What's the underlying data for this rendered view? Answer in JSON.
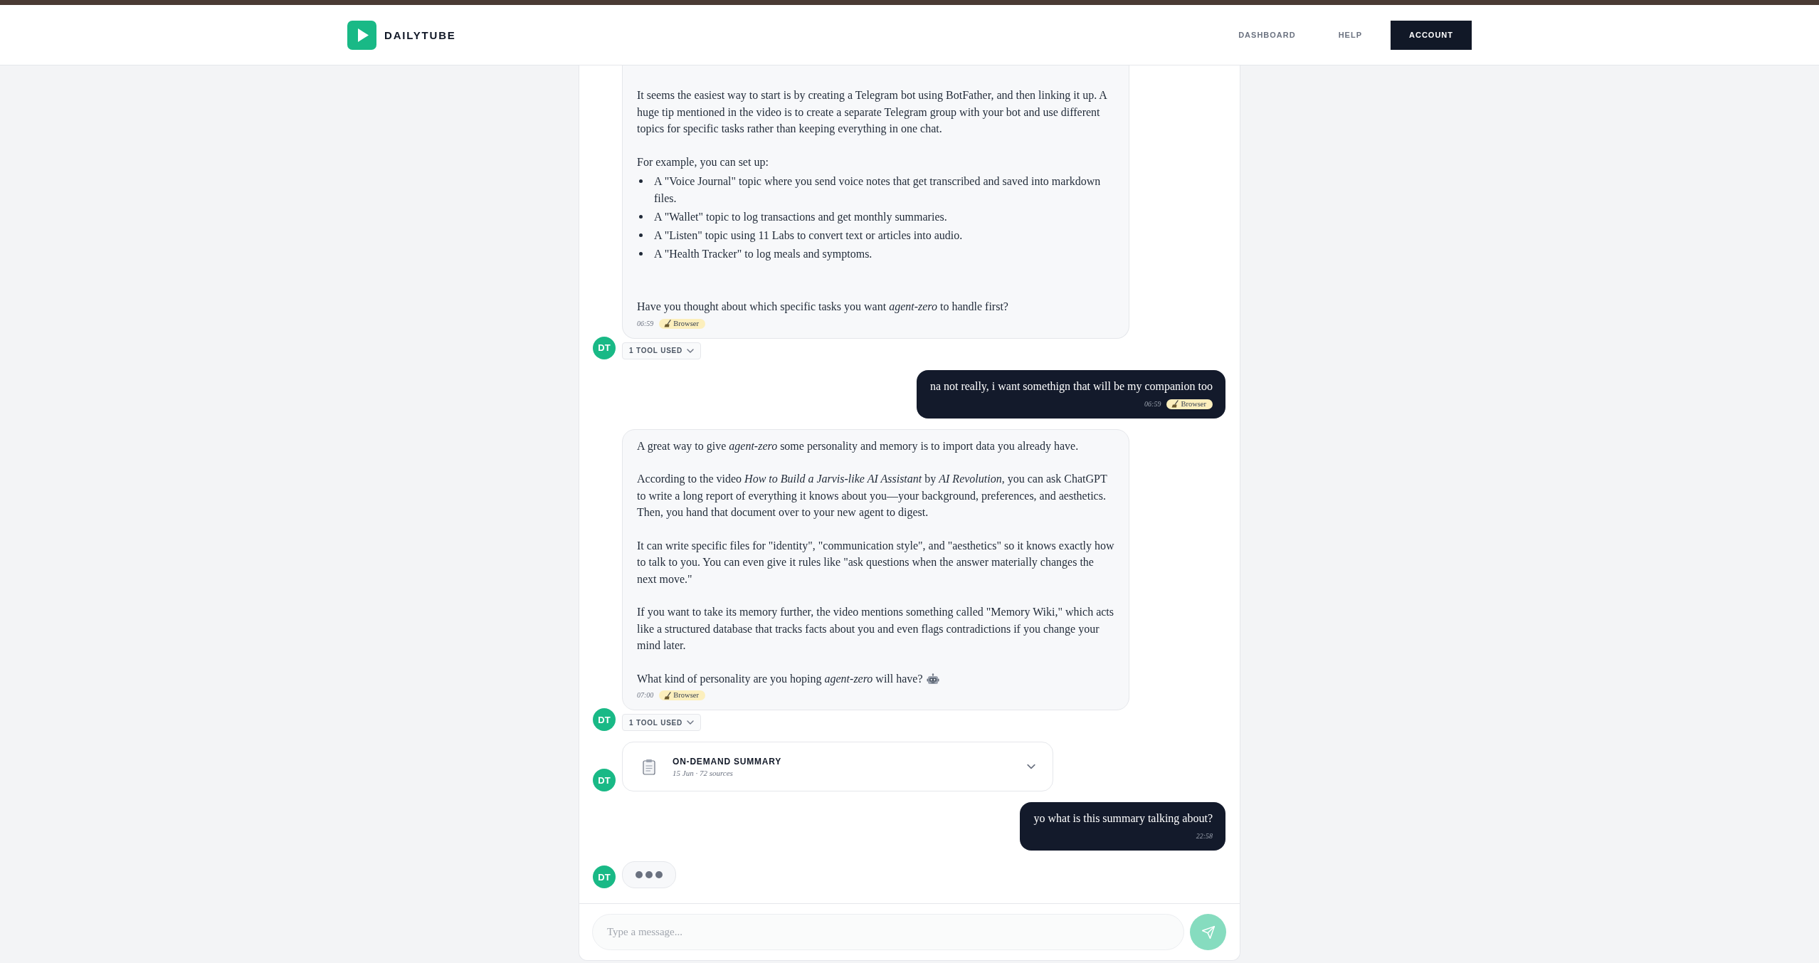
{
  "header": {
    "brand": "DAILYTUBE",
    "nav": [
      {
        "label": "DASHBOARD",
        "kind": "link"
      },
      {
        "label": "HELP",
        "kind": "link"
      },
      {
        "label": "ACCOUNT",
        "kind": "button"
      }
    ]
  },
  "messages": [
    {
      "kind": "bot",
      "avatar": "DT",
      "blocks": [
        {
          "kind": "paragraph",
          "text": "It seems the easiest way to start is by creating a Telegram bot using BotFather, and then linking it up. A huge tip mentioned in the video is to create a separate Telegram group with your bot and use different topics for specific tasks rather than keeping everything in one chat."
        },
        {
          "kind": "paragraph",
          "text": "For example, you can set up:"
        },
        {
          "kind": "list",
          "items": [
            "A \"Voice Journal\" topic where you send voice notes that get transcribed and saved into markdown files.",
            "A \"Wallet\" topic to log transactions and get monthly summaries.",
            "A \"Listen\" topic using 11 Labs to convert text or articles into audio.",
            "A \"Health Tracker\" to log meals and symptoms."
          ]
        },
        {
          "kind": "paragraph",
          "text": "Have you thought about which specific tasks you want *agent-zero* to handle first?"
        }
      ],
      "time": "06:59",
      "tool": "Browser",
      "tools_used": {
        "label": "1 TOOL USED",
        "expanded": false
      }
    },
    {
      "kind": "user",
      "text": "na not really, i want somethign that will be my companion too",
      "time": "06:59",
      "tool": "Browser"
    },
    {
      "kind": "bot",
      "avatar": "DT",
      "blocks": [
        {
          "kind": "paragraph",
          "text": "A great way to give *agent-zero* some personality and memory is to import data you already have."
        },
        {
          "kind": "paragraph",
          "text": "According to the video *How to Build a Jarvis-like AI Assistant* by *AI Revolution*, you can ask ChatGPT to write a long report of everything it knows about you—your background, preferences, and aesthetics. Then, you hand that document over to your new agent to digest."
        },
        {
          "kind": "paragraph",
          "text": "It can write specific files for \"identity\", \"communication style\", and \"aesthetics\" so it knows exactly how to talk to you. You can even give it rules like \"ask questions when the answer materially changes the next move.\""
        },
        {
          "kind": "paragraph",
          "text": "If you want to take its memory further, the video mentions something called \"Memory Wiki,\" which acts like a structured database that tracks facts about you and even flags contradictions if you change your mind later."
        },
        {
          "kind": "emoji",
          "text": "What kind of personality are you hoping *agent-zero* will have?"
        }
      ],
      "time": "07:00",
      "tool": "Browser",
      "tools_used": {
        "label": "1 TOOL USED",
        "expanded": false
      }
    },
    {
      "kind": "summary",
      "avatar": "DT",
      "title": "ON-DEMAND SUMMARY",
      "subtitle": "15 Jun · 72 sources",
      "expanded": false
    },
    {
      "kind": "user",
      "text": "yo what is this summary talking about?",
      "time": "22:58"
    },
    {
      "kind": "typing",
      "avatar": "DT"
    }
  ],
  "composer": {
    "placeholder": "Type a message...",
    "send_disabled": true
  }
}
